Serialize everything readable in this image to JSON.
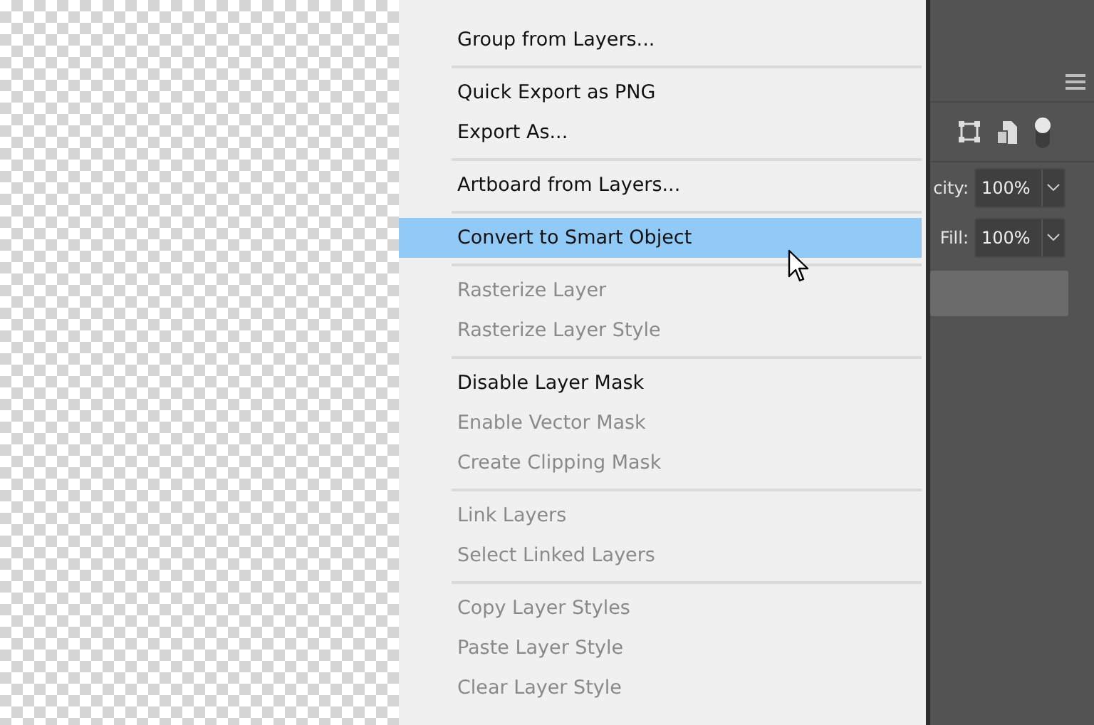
{
  "menu": {
    "groups": [
      {
        "items": [
          {
            "label": "Group from Layers...",
            "disabled": false,
            "selected": false
          }
        ]
      },
      {
        "items": [
          {
            "label": "Quick Export as PNG",
            "disabled": false,
            "selected": false
          },
          {
            "label": "Export As...",
            "disabled": false,
            "selected": false
          }
        ]
      },
      {
        "items": [
          {
            "label": "Artboard from Layers...",
            "disabled": false,
            "selected": false
          }
        ]
      },
      {
        "items": [
          {
            "label": "Convert to Smart Object",
            "disabled": false,
            "selected": true
          }
        ]
      },
      {
        "items": [
          {
            "label": "Rasterize Layer",
            "disabled": true,
            "selected": false
          },
          {
            "label": "Rasterize Layer Style",
            "disabled": true,
            "selected": false
          }
        ]
      },
      {
        "items": [
          {
            "label": "Disable Layer Mask",
            "disabled": false,
            "selected": false
          },
          {
            "label": "Enable Vector Mask",
            "disabled": true,
            "selected": false
          },
          {
            "label": "Create Clipping Mask",
            "disabled": true,
            "selected": false
          }
        ]
      },
      {
        "items": [
          {
            "label": "Link Layers",
            "disabled": true,
            "selected": false
          },
          {
            "label": "Select Linked Layers",
            "disabled": true,
            "selected": false
          }
        ]
      },
      {
        "items": [
          {
            "label": "Copy Layer Styles",
            "disabled": true,
            "selected": false
          },
          {
            "label": "Paste Layer Style",
            "disabled": true,
            "selected": false
          },
          {
            "label": "Clear Layer Style",
            "disabled": true,
            "selected": false
          }
        ]
      }
    ]
  },
  "layers_panel": {
    "fields": [
      {
        "label": "city:",
        "value": "100%"
      },
      {
        "label": "Fill:",
        "value": "100%"
      }
    ]
  }
}
